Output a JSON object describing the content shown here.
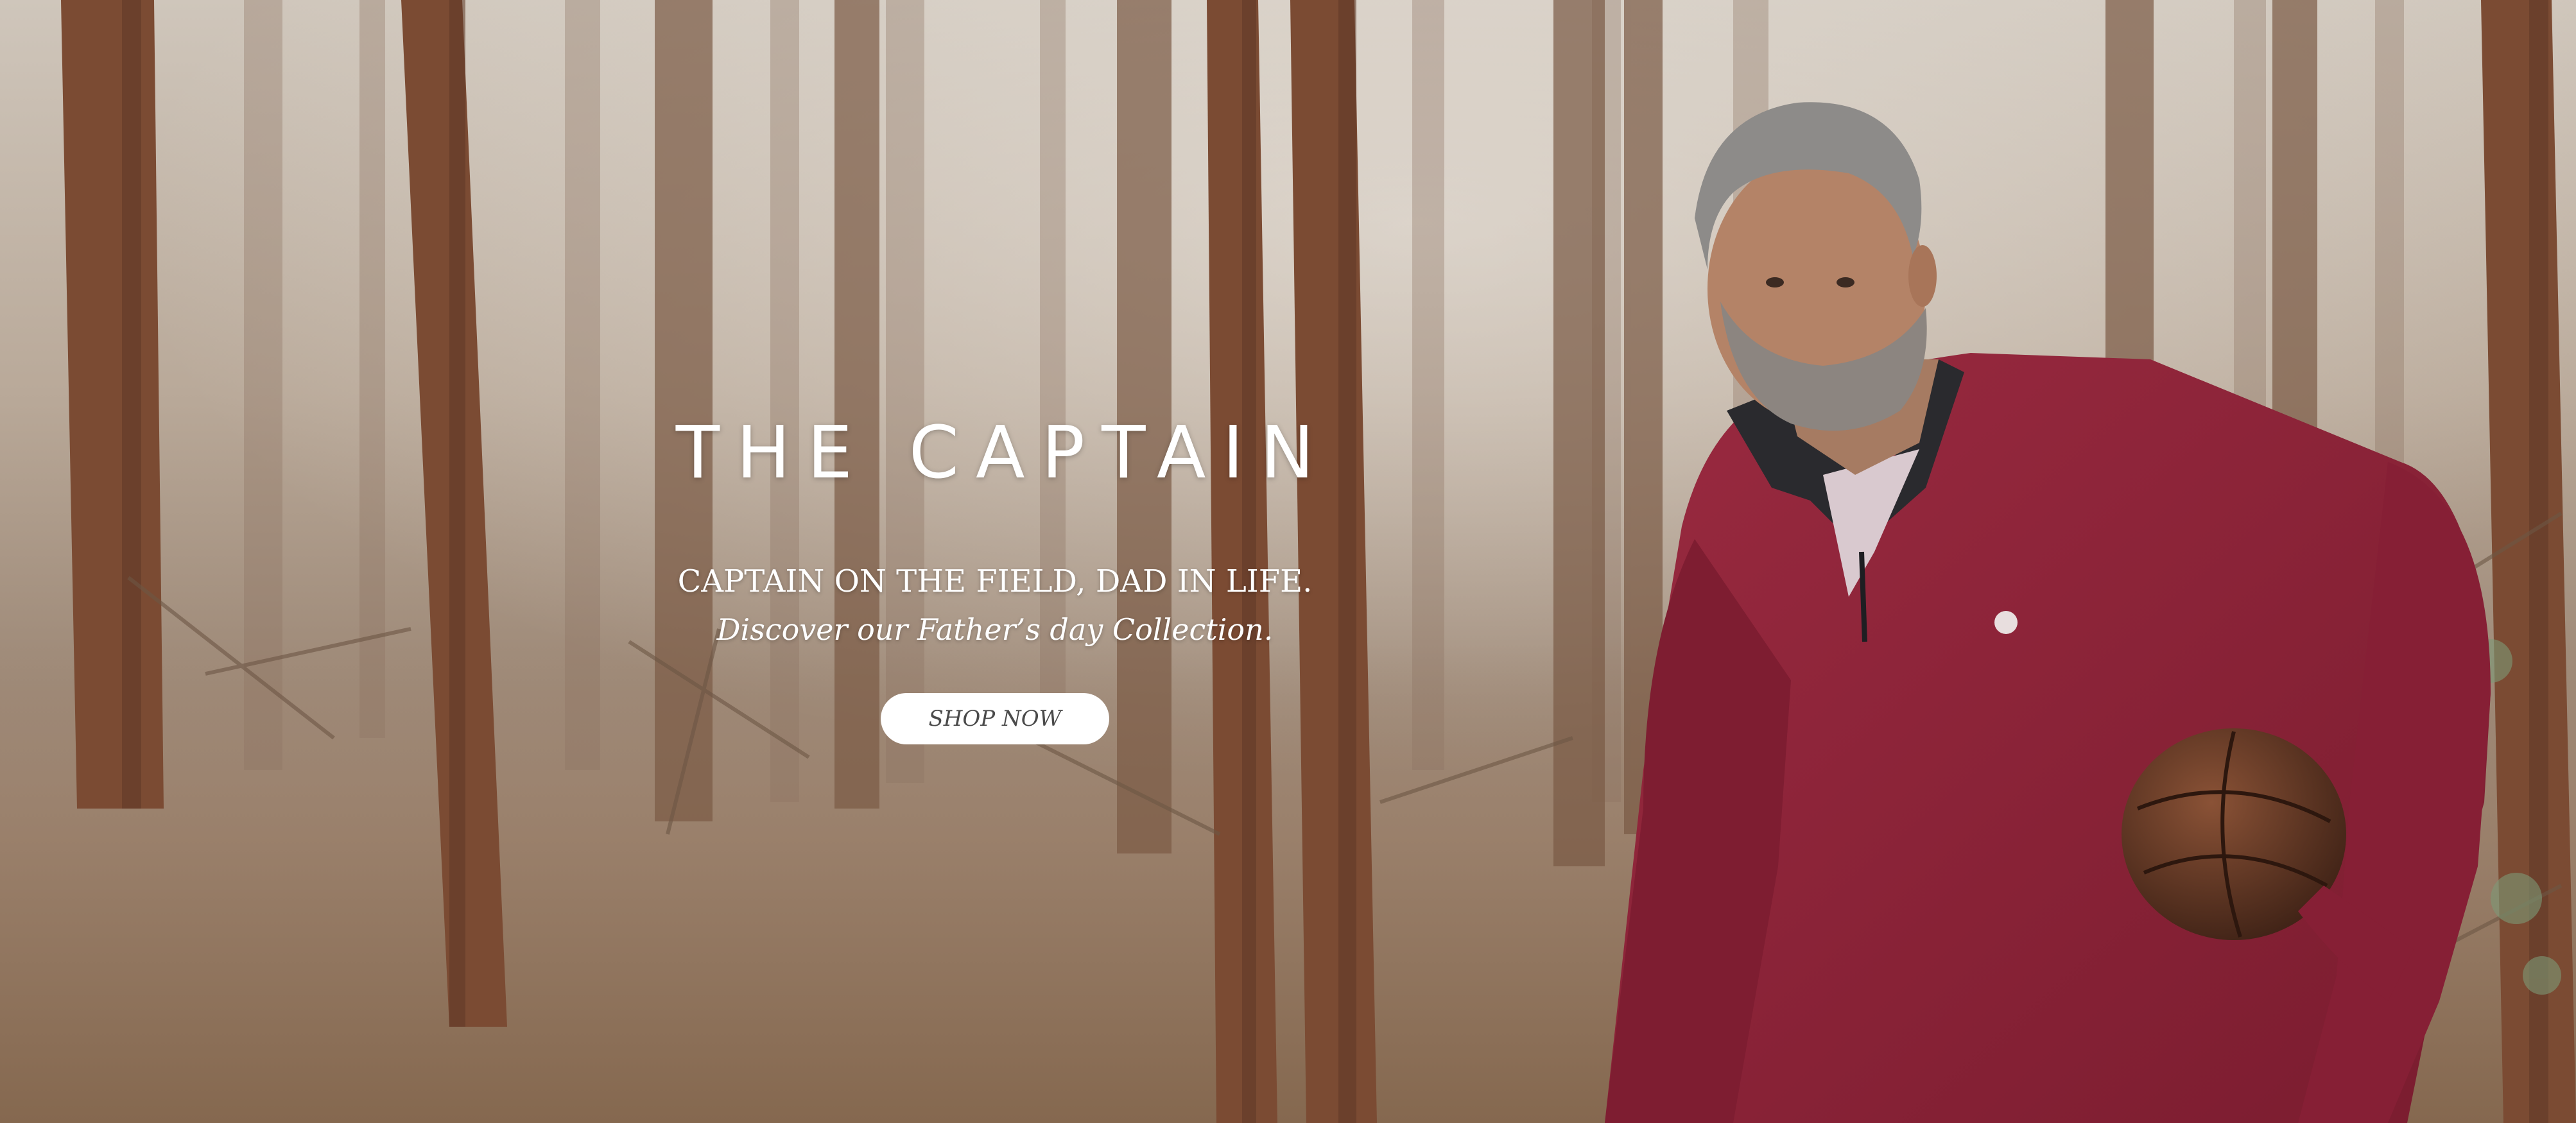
{
  "hero": {
    "headline": "THE CAPTAIN",
    "tagline": "CAPTAIN ON THE FIELD, DAD IN LIFE.",
    "subline": "Discover our Father’s day Collection.",
    "cta_label": "SHOP NOW"
  },
  "colors": {
    "sweater": "#8e2438",
    "button_bg": "#ffffff",
    "text": "#ffffff",
    "forest_floor": "#8f7560"
  },
  "icons": {
    "chest_logo": "lion-crest-icon"
  }
}
